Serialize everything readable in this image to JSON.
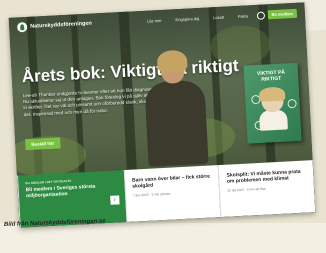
{
  "header": {
    "logo_text": "Naturskyddsföreningen",
    "nav": [
      "Läs mer",
      "Engagera dig",
      "Lokalt",
      "Fakta"
    ],
    "cta_label": "Bli medlem"
  },
  "hero": {
    "headline": "Årets bok: Viktigt på riktigt",
    "intro": "Lee-ah Thunber undgjorde tv-äventer efter att hon fått diagnosen. Nu aktualiserar sej ut den antagen. Bok föreslog vi på själv att skicka in skrifter. Det var väl och pinsamt och oförberedd slank, ska rädda det. Inspirerad med och men då för natur.",
    "cta_label": "Beställ här"
  },
  "book": {
    "title": "VIKTIGT PÅ RIKTIGT"
  },
  "cards": [
    {
      "kicker": "BLI MEDLEM I DET VIKTIGASTE",
      "title": "Bli medlem i Sveriges största miljöorganisation",
      "meta": ""
    },
    {
      "kicker": "",
      "title": "Barn vann över bilar – fick större skolgård",
      "meta": "7 dec 2023 · 3 min att läsa"
    },
    {
      "kicker": "",
      "title": "Skolsplit: Vi måste kunna prata om problemen med klimat",
      "meta": "30 okt 2023 · 4 min att läsa"
    }
  ],
  "caption": "Bild från Naturskyddsföreningen.se",
  "colors": {
    "brand_green": "#2d8a43",
    "accent_green": "#7ac143"
  }
}
